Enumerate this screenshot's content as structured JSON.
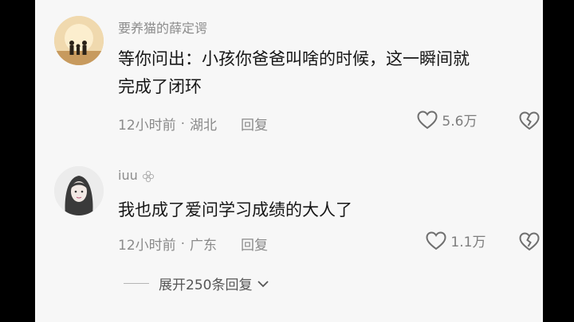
{
  "comments": [
    {
      "username": "要养猫的薛定谔",
      "text_line1": "等你问出：小孩你爸爸叫啥的时候，这一瞬间就",
      "text_line2": "完成了闭环",
      "time": "12小时前",
      "location": "湖北",
      "reply_label": "回复",
      "likes": "5.6万"
    },
    {
      "username": "iuu",
      "text_line1": "我也成了爱问学习成绩的大人了",
      "time": "12小时前",
      "location": "广东",
      "reply_label": "回复",
      "likes": "1.1万"
    }
  ],
  "expand_replies": "展开250条回复",
  "dot": "·",
  "colors": {
    "background": "#f7f7f7",
    "text": "#161616",
    "meta": "#8a8a8a"
  }
}
